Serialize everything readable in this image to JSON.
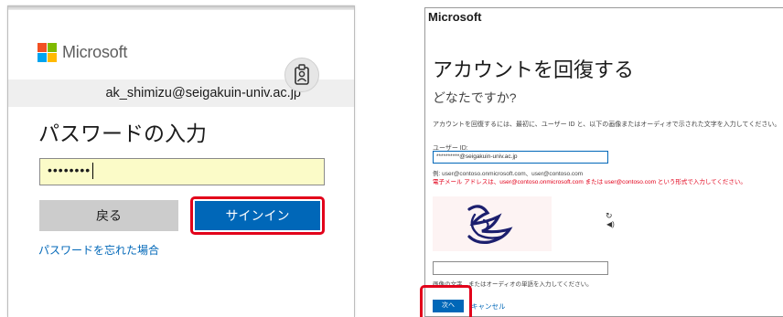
{
  "left": {
    "brand": "Microsoft",
    "logo_colors": [
      "#f25022",
      "#7fba00",
      "#00a4ef",
      "#ffb900"
    ],
    "account": "ak_shimizu@seigakuin-univ.ac.jp",
    "badge_icon": "id-badge-icon",
    "title": "パスワードの入力",
    "password_value": "••••••••",
    "back_label": "戻る",
    "signin_label": "サインイン",
    "forgot_link": "パスワードを忘れた場合",
    "highlight_color": "#e2001a",
    "accent": "#0067b8"
  },
  "right": {
    "brand": "Microsoft",
    "title": "アカウントを回復する",
    "subtitle": "どなたですか?",
    "instruction": "アカウントを回復するには、最初に、ユーザー ID と、以下の画像またはオーディオで示された文字を入力してください。",
    "uid_label": "ユーザー ID:",
    "uid_value": "**********@seigakuin-univ.ac.jp",
    "example": "例: user@contoso.onmicrosoft.com、user@contoso.com",
    "error": "電子メール アドレスは、user@contoso.onmicrosoft.com または user@contoso.com という形式で入力してください。",
    "speaker_icon": "speaker-icon",
    "refresh_icon": "refresh-icon",
    "answer_hint": "画像の文字、またはオーディオの単語を入力してください。",
    "next_label": "次へ",
    "cancel_label": "キャンセル"
  }
}
